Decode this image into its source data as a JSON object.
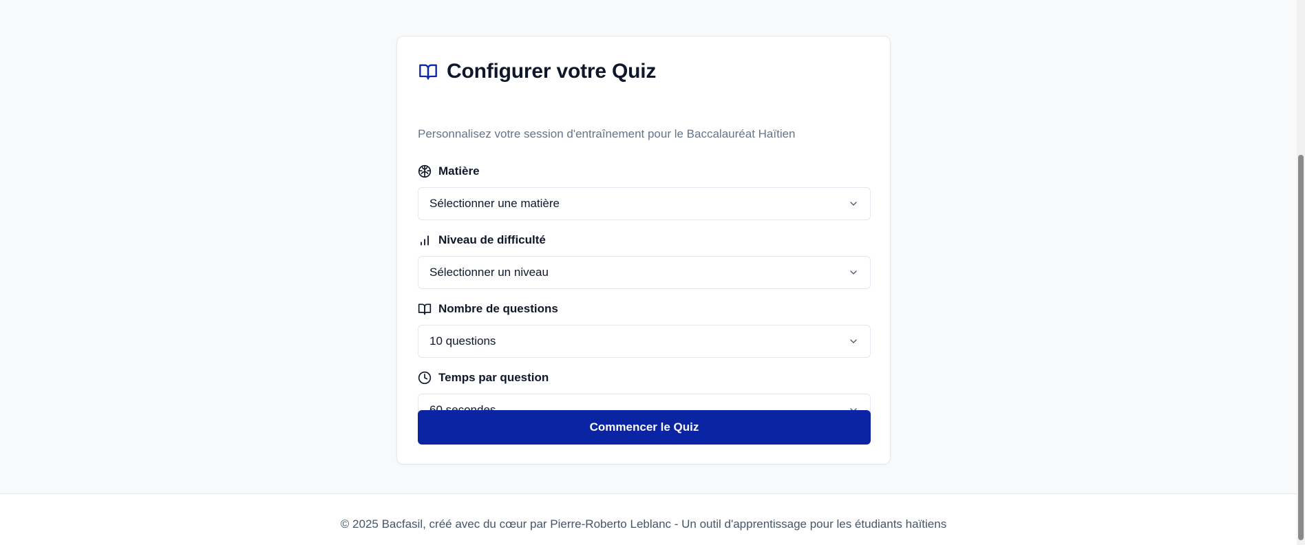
{
  "quiz_config": {
    "title": "Configurer votre Quiz",
    "subtitle": "Personnalisez votre session d'entraînement pour le Baccalauréat Haïtien",
    "fields": {
      "subject": {
        "label": "Matière",
        "value": "Sélectionner une matière",
        "icon": "brain-icon"
      },
      "difficulty": {
        "label": "Niveau de difficulté",
        "value": "Sélectionner un niveau",
        "icon": "signal-bars-icon"
      },
      "question_count": {
        "label": "Nombre de questions",
        "value": "10 questions",
        "icon": "book-open-icon"
      },
      "time_per_question": {
        "label": "Temps par question",
        "value": "60 secondes",
        "icon": "clock-icon"
      }
    },
    "start_button_label": "Commencer le Quiz"
  },
  "footer": {
    "text": "© 2025 Bacfasil, créé avec du cœur par Pierre-Roberto Leblanc - Un outil d'apprentissage pour les étudiants haïtiens"
  },
  "colors": {
    "accent": "#0a24a3",
    "page_background": "#f8f9fb",
    "card_background": "#ffffff",
    "muted_text": "#64748b"
  }
}
